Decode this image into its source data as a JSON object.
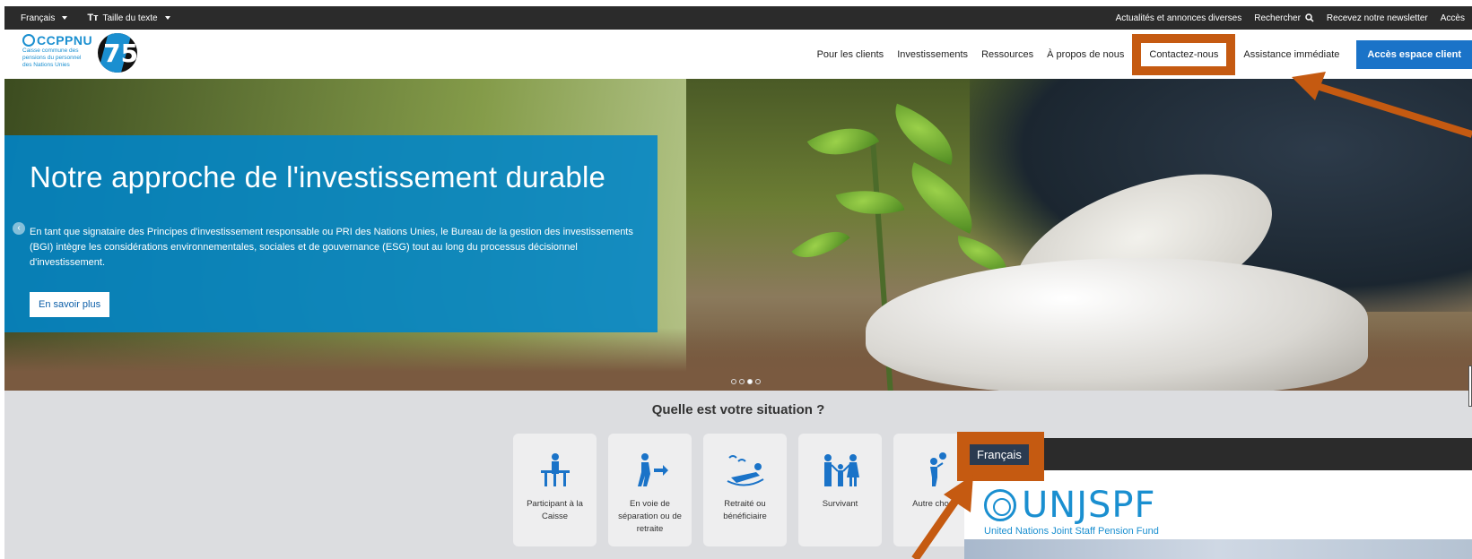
{
  "topbar": {
    "language": "Français",
    "text_size": "Taille du texte",
    "links": [
      "Actualités et annonces diverses",
      "Rechercher",
      "Recevez notre newsletter",
      "Accès"
    ]
  },
  "header": {
    "logo_brand": "CCPPNU",
    "logo_sub": [
      "Caisse commune des",
      "pensions du personnel",
      "des Nations Unies"
    ],
    "anniversary": "75",
    "nav": {
      "clients": "Pour les clients",
      "investments": "Investissements",
      "resources": "Ressources",
      "about": "À propos de nous",
      "contact": "Contactez-nous",
      "assistance": "Assistance immédiate",
      "client_space": "Accès espace client"
    }
  },
  "hero": {
    "title": "Notre approche de l'investissement durable",
    "text": "En tant que signataire des Principes d'investissement responsable ou PRI des Nations Unies, le Bureau de la gestion des investissements (BGI) intègre les considérations environnementales, sociales et de gouvernance (ESG) tout au long du processus décisionnel d'investissement.",
    "button": "En savoir plus",
    "slides": 4,
    "active_slide": 3
  },
  "situation": {
    "title": "Quelle est votre situation ?",
    "cards": [
      {
        "label": "Participant à la Caisse",
        "icon": "desk-person-icon"
      },
      {
        "label": "En voie de séparation ou de retraite",
        "icon": "person-exit-icon"
      },
      {
        "label": "Retraité ou bénéficiaire",
        "icon": "retiree-relaxing-icon"
      },
      {
        "label": "Survivant",
        "icon": "family-icon"
      },
      {
        "label": "Autre chose",
        "icon": "person-question-icon"
      }
    ]
  },
  "popup": {
    "language_button": "Français",
    "brand": "UNJSPF",
    "brand_sub": "United Nations Joint Staff Pension Fund"
  },
  "colors": {
    "accent": "#1a73c8",
    "brand_blue": "#1a8fd0",
    "annotation": "#c55a11",
    "topbar": "#2b2b2b"
  }
}
